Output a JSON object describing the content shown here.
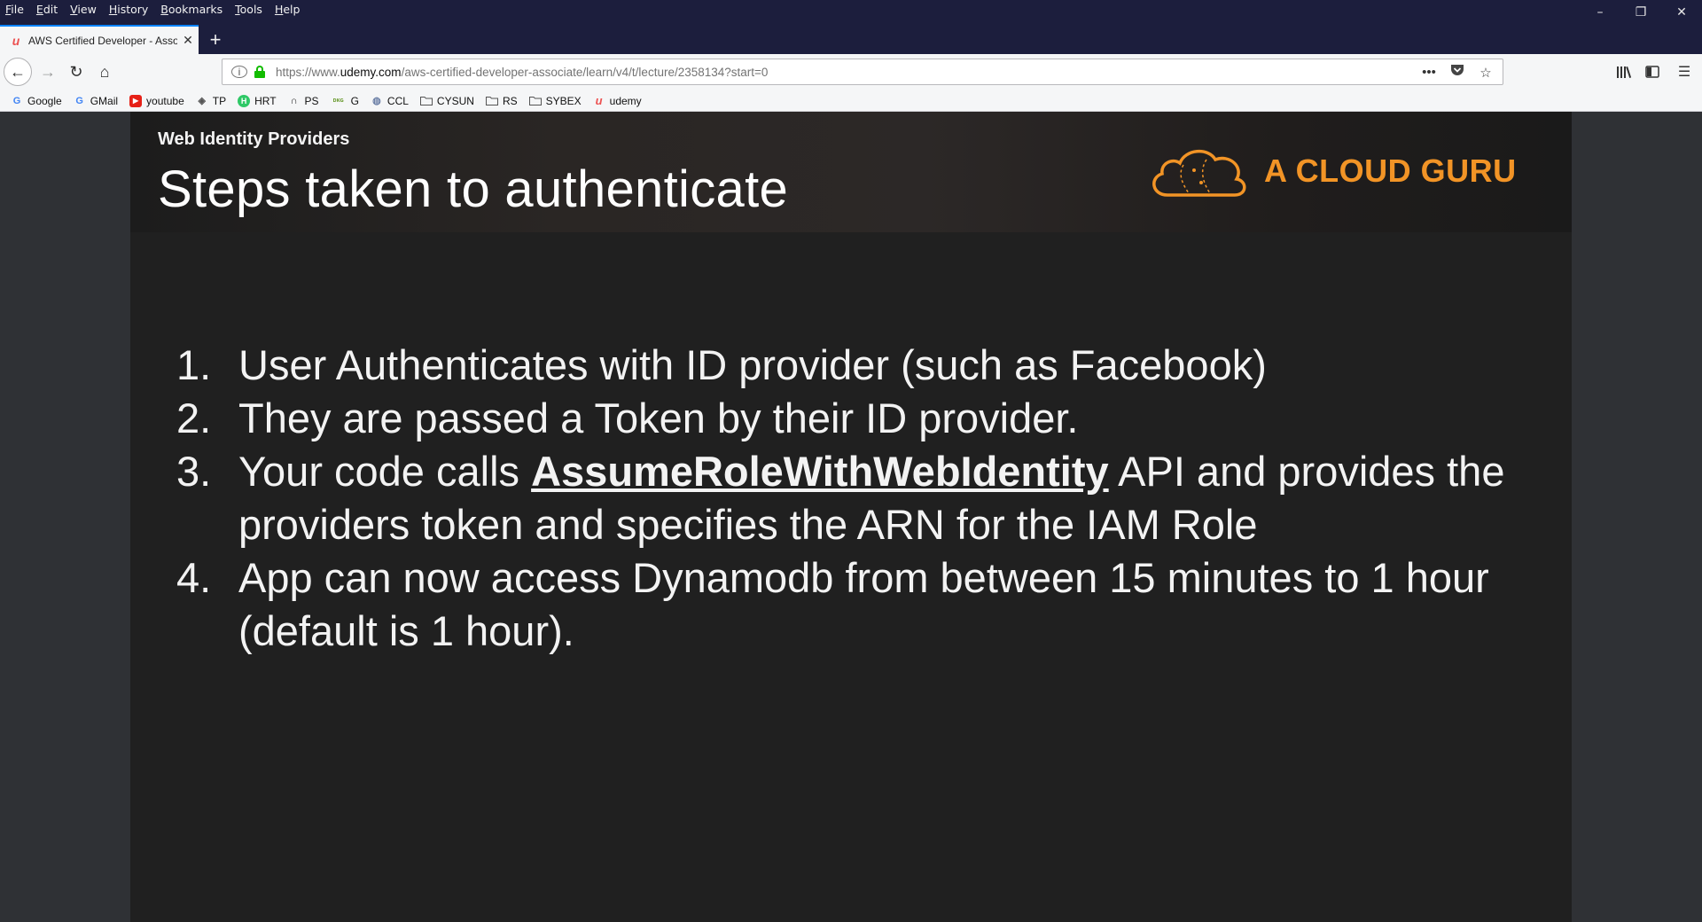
{
  "menu": {
    "items": [
      {
        "u": "F",
        "rest": "ile"
      },
      {
        "u": "E",
        "rest": "dit"
      },
      {
        "u": "V",
        "rest": "iew"
      },
      {
        "u": "H",
        "rest": "istory"
      },
      {
        "u": "B",
        "rest": "ookmarks"
      },
      {
        "u": "T",
        "rest": "ools"
      },
      {
        "u": "H",
        "rest": "elp"
      }
    ]
  },
  "window": {
    "minimize": "–",
    "restore": "❐",
    "close": "✕"
  },
  "tab": {
    "title": "AWS Certified Developer - Asso",
    "favicon": "udemy-icon",
    "close": "✕",
    "new_tab": "+"
  },
  "nav": {
    "back": "←",
    "forward": "→",
    "reload": "↻",
    "home": "⌂"
  },
  "url": {
    "prefix": "https://www.",
    "domain": "udemy.com",
    "path": "/aws-certified-developer-associate/learn/v4/t/lecture/2358134?start=0",
    "more": "•••",
    "pocket": "pocket-icon",
    "star": "☆"
  },
  "toolbar": {
    "library": "library-icon",
    "sidebar": "sidebar-icon",
    "menu": "☰"
  },
  "bookmarks": [
    {
      "label": "Google",
      "icon": "G",
      "color": "#4285f4"
    },
    {
      "label": "GMail",
      "icon": "G",
      "color": "#4285f4"
    },
    {
      "label": "youtube",
      "icon": "▶",
      "color": "#e62117"
    },
    {
      "label": "TP",
      "icon": "◈",
      "color": "#555555"
    },
    {
      "label": "HRT",
      "icon": "H",
      "color": "#2ec866"
    },
    {
      "label": "PS",
      "icon": "∩",
      "color": "#222222"
    },
    {
      "label": "G",
      "icon": "ᴅᴋɢ",
      "color": "#6a9a2f"
    },
    {
      "label": "CCL",
      "icon": "◍",
      "color": "#6b7fa6"
    },
    {
      "label": "CYSUN",
      "icon": "▭",
      "color": "#555555"
    },
    {
      "label": "RS",
      "icon": "▭",
      "color": "#555555"
    },
    {
      "label": "SYBEX",
      "icon": "▭",
      "color": "#555555"
    },
    {
      "label": "udemy",
      "icon": "u",
      "color": "#ec5252"
    }
  ],
  "slide": {
    "subtitle": "Web Identity Providers",
    "title": "Steps taken to authenticate",
    "logo_text": "A CLOUD GURU",
    "steps": [
      {
        "num": "1.",
        "text": "User Authenticates with ID provider (such as Facebook)"
      },
      {
        "num": "2.",
        "text": "They are passed a Token by their ID provider."
      },
      {
        "num": "3.",
        "before": "Your code calls ",
        "api": "AssumeRoleWithWebIdentity",
        "after": " API and provides the providers token and specifies the ARN for the IAM Role"
      },
      {
        "num": "4.",
        "text": "App can now access Dynamodb from between 15 minutes to 1 hour (default is 1 hour)."
      }
    ]
  },
  "colors": {
    "brand_orange": "#f29426",
    "titlebar": "#1c1e3d",
    "slide_bg": "#202020"
  }
}
